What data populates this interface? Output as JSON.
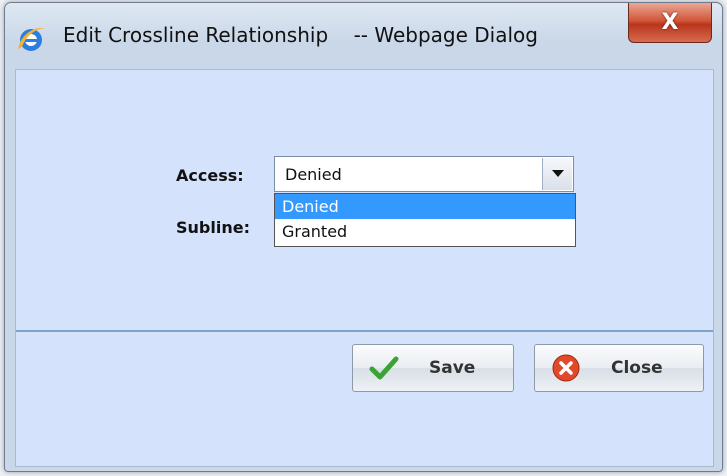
{
  "window": {
    "title": "Edit Crossline Relationship    -- Webpage Dialog",
    "close_glyph": "X"
  },
  "form": {
    "access_label": "Access:",
    "subline_label": "Subline:",
    "access_value": "Denied",
    "access_options": [
      "Denied",
      "Granted"
    ],
    "access_highlighted": "Denied"
  },
  "buttons": {
    "save_label": "Save",
    "close_label": "Close"
  },
  "icons": {
    "title": "ie-icon",
    "dropdown": "chevron-down-icon",
    "save": "checkmark-icon",
    "close": "close-circle-icon"
  },
  "colors": {
    "client_bg": "#d4e3fb",
    "highlight": "#3399ff",
    "close_button": "#c7432a",
    "check_green": "#39a335",
    "close_icon_red": "#e04a2a"
  }
}
